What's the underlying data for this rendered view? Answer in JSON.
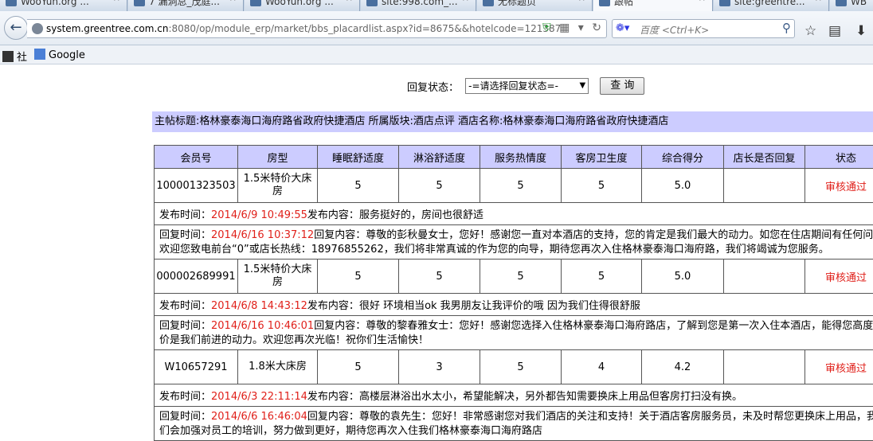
{
  "browser": {
    "tabs": [
      {
        "label": "WooYun.org ..."
      },
      {
        "label": "7 漏洞总_茂庭..."
      },
      {
        "label": "WooYun.org ..."
      },
      {
        "label": "site:998.com_..."
      },
      {
        "label": "无标题页"
      },
      {
        "label": "跟帖"
      },
      {
        "label": "site:greentre..."
      },
      {
        "label": "WB"
      }
    ],
    "url_host": "system.greentree.com.cn",
    "url_rest": ":8080/op/module_erp/market/bbs_placardlist.aspx?id=8675&&hotelcode=121387",
    "search_placeholder": "百度 <Ctrl+K>",
    "bookmarks": [
      {
        "label": "社"
      },
      {
        "label": "Google"
      }
    ]
  },
  "filter": {
    "label": "回复状态：",
    "selected": "-=请选择回复状态=-",
    "button": "查 询"
  },
  "thread": {
    "info": "主帖标题:格林豪泰海口海府路省政府快捷酒店 所属版块:酒店点评 酒店名称:格林豪泰海口海府路省政府快捷酒店"
  },
  "table": {
    "headers": [
      "会员号",
      "房型",
      "睡眠舒适度",
      "淋浴舒适度",
      "服务热情度",
      "客房卫生度",
      "综合得分",
      "店长是否回复",
      "状态"
    ],
    "entries": [
      {
        "member": "100001323503",
        "room": "1.5米特价大床房",
        "sleep": "5",
        "shower": "5",
        "service": "5",
        "clean": "5",
        "score": "5.0",
        "replied": "",
        "status": "审核通过",
        "post_time_label": "发布时间：",
        "post_time": "2014/6/9 10:49:55",
        "post_content_label": "发布内容：",
        "post_content": "服务挺好的，房间也很舒适",
        "reply_time_label": "回复时间：",
        "reply_time": "2014/6/16 10:37:12",
        "reply_content_label": "回复内容：",
        "reply_content": "尊敬的彭秋曼女士，您好！感谢您一直对本酒店的支持，您的肯定是我们最大的动力。如您在住店期间有任何问题欢迎您致电前台“0”或店长热线：18976855262，我们将非常真诚的作为您的向导，期待您再次入住格林豪泰海口海府路，我们将竭诚为您服务。"
      },
      {
        "member": "000002689991",
        "room": "1.5米特价大床房",
        "sleep": "5",
        "shower": "5",
        "service": "5",
        "clean": "5",
        "score": "5.0",
        "replied": "",
        "status": "审核通过",
        "post_time_label": "发布时间：",
        "post_time": "2014/6/8 14:43:12",
        "post_content_label": "发布内容：",
        "post_content": "很好 环境相当ok 我男朋友让我评价的哦 因为我们住得很舒服",
        "reply_time_label": "回复时间：",
        "reply_time": "2014/6/16 10:46:01",
        "reply_content_label": "回复内容：",
        "reply_content": "尊敬的黎春雅女士：您好！感谢您选择入住格林豪泰海口海府路店，了解到您是第一次入住本酒店，能得您高度评价是我们前进的动力。欢迎您再次光临！祝你们生活愉快！"
      },
      {
        "member": "W10657291",
        "room": "1.8米大床房",
        "sleep": "5",
        "shower": "3",
        "service": "5",
        "clean": "4",
        "score": "4.2",
        "replied": "",
        "status": "审核通过",
        "post_time_label": "发布时间：",
        "post_time": "2014/6/3 22:11:14",
        "post_content_label": "发布内容：",
        "post_content": "高楼层淋浴出水太小，希望能解决，另外都告知需要换床上用品但客房打扫没有换。",
        "reply_time_label": "回复时间：",
        "reply_time": "2014/6/6 16:46:04",
        "reply_content_label": "回复内容：",
        "reply_content": "尊敬的袁先生：您好！非常感谢您对我们酒店的关注和支持！关于酒店客房服务员，未及时帮您更换床上用品，我们会加强对员工的培训，努力做到更好，期待您再次入住我们格林豪泰海口海府路店"
      }
    ]
  }
}
